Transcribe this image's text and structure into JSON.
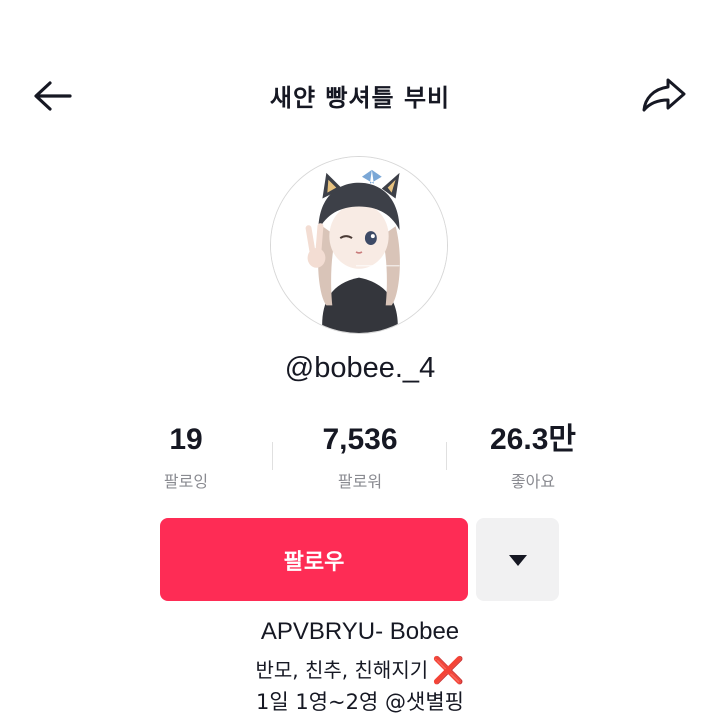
{
  "header": {
    "title": "새얀 빵셔틀 부비",
    "back_icon": "arrow-left-icon",
    "share_icon": "share-arrow-icon"
  },
  "profile": {
    "avatar_icon": "avatar-image",
    "username": "@bobee._4"
  },
  "stats": [
    {
      "value": "19",
      "label": "팔로잉"
    },
    {
      "value": "7,536",
      "label": "팔로워"
    },
    {
      "value": "26.3만",
      "label": "좋아요"
    }
  ],
  "actions": {
    "follow_label": "팔로우",
    "follow_color": "#fe2c55",
    "more_icon": "caret-down-icon"
  },
  "bio": {
    "name": "APVBRYU- Bobee",
    "line1": "반모, 친추, 친해지기",
    "line1_mark": "❌",
    "line2": "1일 1영~2영 @샛별핑"
  }
}
